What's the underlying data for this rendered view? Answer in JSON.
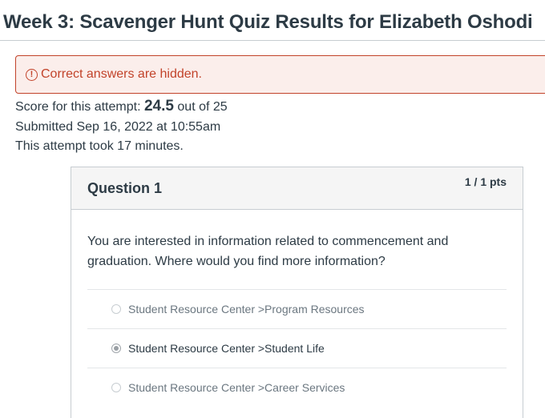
{
  "page": {
    "title": "Week 3: Scavenger Hunt Quiz Results for Elizabeth Oshodi"
  },
  "alert": {
    "icon": "exclamation-circle-icon",
    "glyph": "!",
    "text": "Correct answers are hidden.",
    "color": "#c2432a",
    "background": "#fbeeeb"
  },
  "attempt": {
    "score_prefix": "Score for this attempt:",
    "score_value": "24.5",
    "score_suffix": "out of 25",
    "submitted": "Submitted Sep 16, 2022 at 10:55am",
    "duration": "This attempt took 17 minutes."
  },
  "question": {
    "name": "Question 1",
    "points": "1 / 1 pts",
    "text": "You are interested in information related to commencement and graduation. Where would you find more information?",
    "answers": [
      {
        "label": "Student Resource Center >Program Resources",
        "selected": false
      },
      {
        "label": "Student Resource Center >Student Life",
        "selected": true
      },
      {
        "label": "Student Resource Center >Career Services",
        "selected": false
      }
    ]
  }
}
